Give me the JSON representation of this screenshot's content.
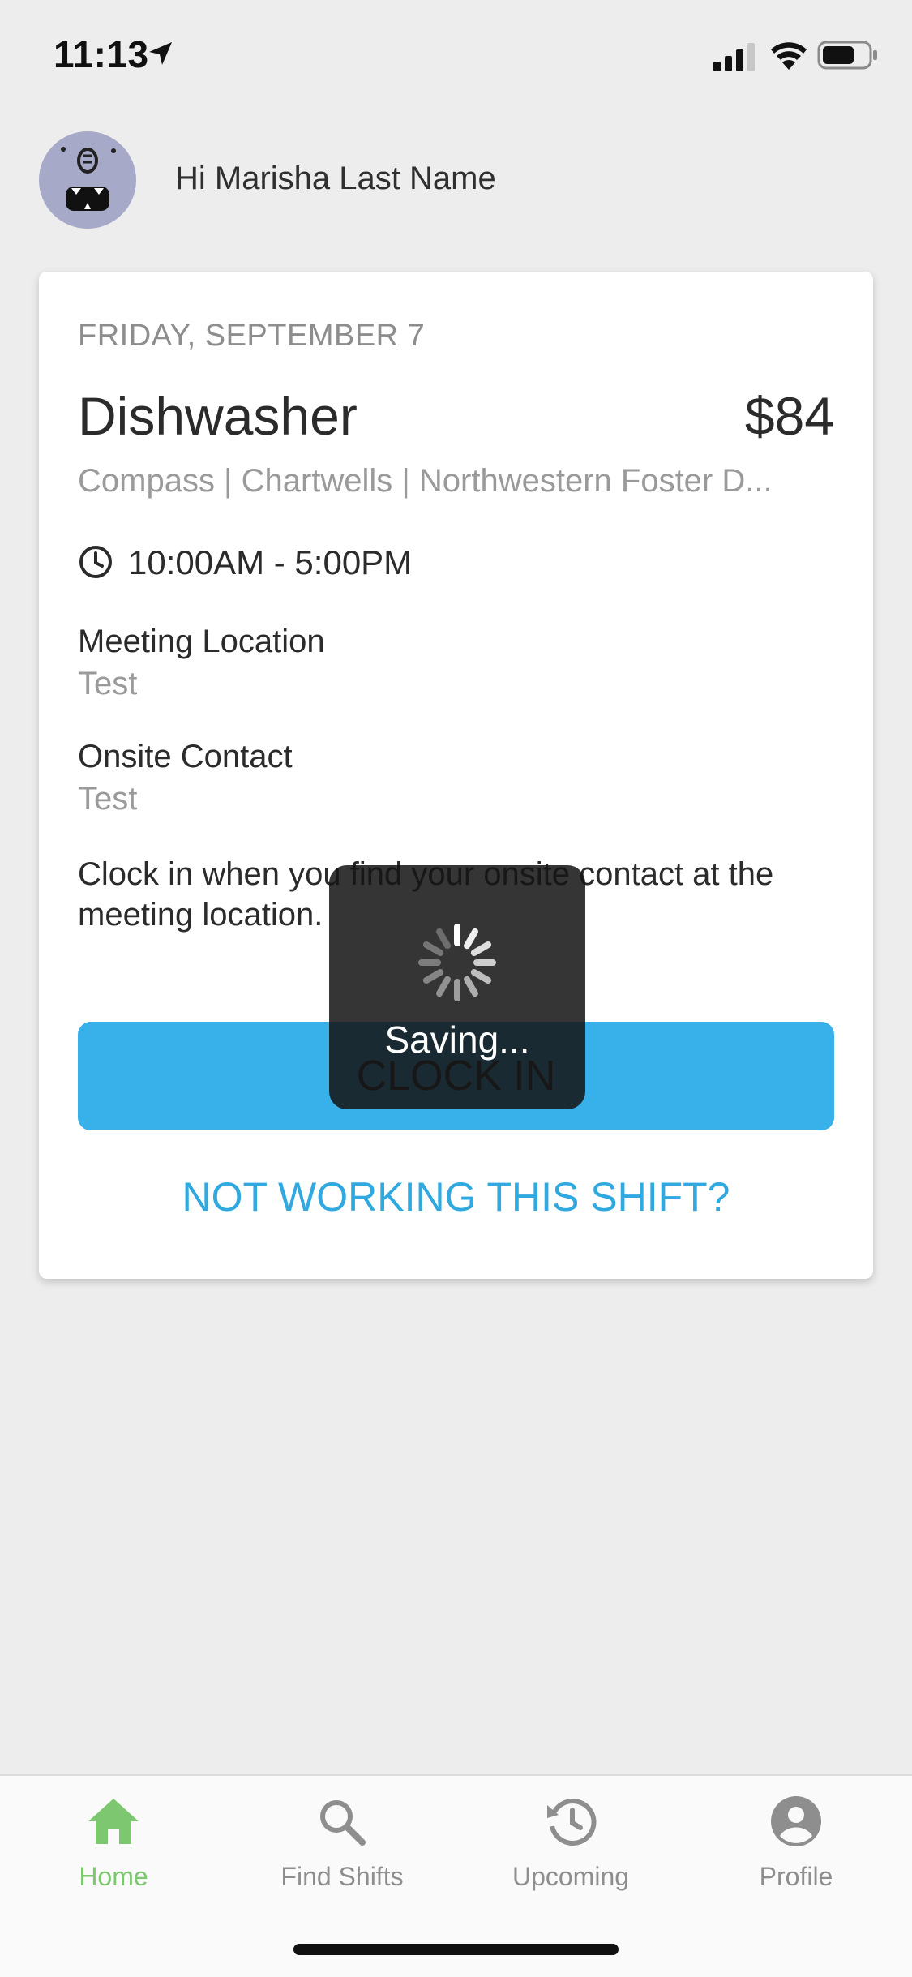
{
  "status_bar": {
    "time": "11:13"
  },
  "greeting": "Hi Marisha Last Name",
  "shift": {
    "date": "FRIDAY, SEPTEMBER 7",
    "title": "Dishwasher",
    "pay": "$84",
    "location": "Compass | Chartwells | Northwestern Foster D...",
    "time_range": "10:00AM - 5:00PM",
    "meeting_location_label": "Meeting Location",
    "meeting_location_value": "Test",
    "onsite_contact_label": "Onsite Contact",
    "onsite_contact_value": "Test",
    "instructions": "Clock in when you find your onsite contact at the meeting location.",
    "clock_in_label": "CLOCK IN",
    "not_working_label": "NOT WORKING THIS SHIFT?"
  },
  "overlay": {
    "saving_text": "Saving..."
  },
  "tabs": [
    {
      "label": "Home",
      "icon": "home-icon",
      "active": true
    },
    {
      "label": "Find Shifts",
      "icon": "search-icon",
      "active": false
    },
    {
      "label": "Upcoming",
      "icon": "history-clock-icon",
      "active": false
    },
    {
      "label": "Profile",
      "icon": "profile-icon",
      "active": false
    }
  ],
  "colors": {
    "background": "#ededed",
    "accent_blue": "#38b0ea",
    "link_blue": "#30a8e0",
    "active_tab_green": "#7cc76f",
    "inactive_tab_gray": "#8e8e8e"
  }
}
